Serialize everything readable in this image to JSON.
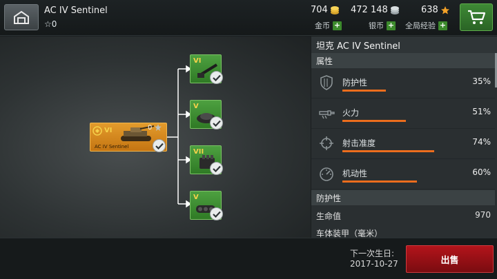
{
  "header": {
    "title": "AC IV Sentinel",
    "stars": "☆0",
    "gold": {
      "amount": "704",
      "label": "金币"
    },
    "silver": {
      "amount": "472 148",
      "label": "银币"
    },
    "free_xp": {
      "amount": "638",
      "label": "全局经验"
    },
    "plus": "+",
    "star_glyph": "☆"
  },
  "tree": {
    "main": {
      "tier": "VI",
      "name": "AC IV Sentinel",
      "xp": "0"
    },
    "modules": [
      {
        "tier": "VI",
        "type": "gun"
      },
      {
        "tier": "V",
        "type": "turret"
      },
      {
        "tier": "VII",
        "type": "engine"
      },
      {
        "tier": "V",
        "type": "suspension"
      }
    ]
  },
  "panel": {
    "title": "坦克  AC IV Sentinel",
    "attributes_header": "属性",
    "stats": [
      {
        "label": "防护性",
        "value": "35%",
        "fraction": 0.35,
        "icon": "shield-icon"
      },
      {
        "label": "火力",
        "value": "51%",
        "fraction": 0.51,
        "icon": "gun-icon"
      },
      {
        "label": "射击准度",
        "value": "74%",
        "fraction": 0.74,
        "icon": "crosshair-icon"
      },
      {
        "label": "机动性",
        "value": "60%",
        "fraction": 0.6,
        "icon": "speedometer-icon"
      }
    ],
    "protection_header": "防护性",
    "hp": {
      "label": "生命值",
      "value": "970"
    },
    "hull_armor": {
      "label": "车体装甲（毫米）"
    }
  },
  "footer": {
    "birthday_label": "下一次生日:",
    "birthday_date": "2017-10-27",
    "sell_label": "出售"
  },
  "colors": {
    "accent_orange": "#ec6d1d",
    "gold": "#f5c842",
    "module_green": "#3f8f35",
    "sell_red": "#a8131a"
  }
}
